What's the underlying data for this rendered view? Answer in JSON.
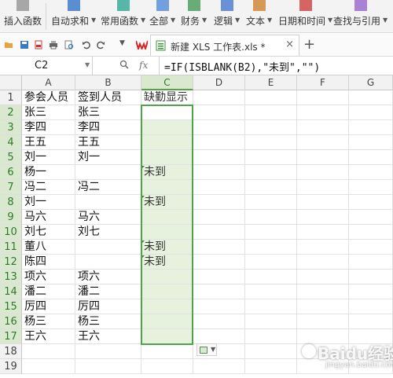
{
  "ribbon": {
    "items": [
      {
        "label": "插入函数",
        "icon": "fx-icon",
        "has_arrow": false
      },
      {
        "label": "自动求和",
        "icon": "sigma-icon",
        "has_arrow": true
      },
      {
        "label": "常用函数",
        "icon": "star-icon",
        "has_arrow": true
      },
      {
        "label": "全部",
        "icon": "list-icon",
        "has_arrow": true
      },
      {
        "label": "财务",
        "icon": "finance-icon",
        "has_arrow": true
      },
      {
        "label": "逻辑",
        "icon": "logic-icon",
        "has_arrow": true
      },
      {
        "label": "文本",
        "icon": "text-icon",
        "has_arrow": true
      },
      {
        "label": "日期和时间",
        "icon": "calendar-icon",
        "has_arrow": true
      },
      {
        "label": "查找与引用",
        "icon": "lookup-icon",
        "has_arrow": true
      }
    ]
  },
  "tab": {
    "title": "新建 XLS 工作表.xls *",
    "close": "×",
    "add": "+"
  },
  "formula_bar": {
    "cell_ref": "C2",
    "fx": "fx",
    "formula": "=IF(ISBLANK(B2),\"未到\",\"\")"
  },
  "columns": [
    "A",
    "B",
    "C",
    "D",
    "E",
    "F",
    "G"
  ],
  "rows": [
    {
      "num": "1",
      "a": "参会人员",
      "b": "签到人员",
      "c": "缺勤显示"
    },
    {
      "num": "2",
      "a": "张三",
      "b": "张三",
      "c": ""
    },
    {
      "num": "3",
      "a": "李四",
      "b": "李四",
      "c": ""
    },
    {
      "num": "4",
      "a": "王五",
      "b": "王五",
      "c": ""
    },
    {
      "num": "5",
      "a": "刘一",
      "b": "刘一",
      "c": ""
    },
    {
      "num": "6",
      "a": "杨一",
      "b": "",
      "c": "未到"
    },
    {
      "num": "7",
      "a": "冯二",
      "b": "冯二",
      "c": ""
    },
    {
      "num": "8",
      "a": "刘一",
      "b": "",
      "c": "未到"
    },
    {
      "num": "9",
      "a": "马六",
      "b": "马六",
      "c": ""
    },
    {
      "num": "10",
      "a": "刘七",
      "b": "刘七",
      "c": ""
    },
    {
      "num": "11",
      "a": "董八",
      "b": "",
      "c": "未到"
    },
    {
      "num": "12",
      "a": "陈四",
      "b": "",
      "c": "未到"
    },
    {
      "num": "13",
      "a": "项六",
      "b": "项六",
      "c": ""
    },
    {
      "num": "14",
      "a": "潘二",
      "b": "潘二",
      "c": ""
    },
    {
      "num": "15",
      "a": "厉四",
      "b": "厉四",
      "c": ""
    },
    {
      "num": "16",
      "a": "杨三",
      "b": "杨三",
      "c": ""
    },
    {
      "num": "17",
      "a": "王六",
      "b": "王六",
      "c": ""
    },
    {
      "num": "18",
      "a": "",
      "b": "",
      "c": ""
    },
    {
      "num": "19",
      "a": "",
      "b": "",
      "c": ""
    }
  ],
  "watermark": {
    "text": "Baidu经验",
    "sub": "jingyan.baidu.com"
  },
  "colors": {
    "selection": "#4fa34a",
    "selection_fill": "#e6f2de",
    "header_active": "#d9e8cf"
  }
}
